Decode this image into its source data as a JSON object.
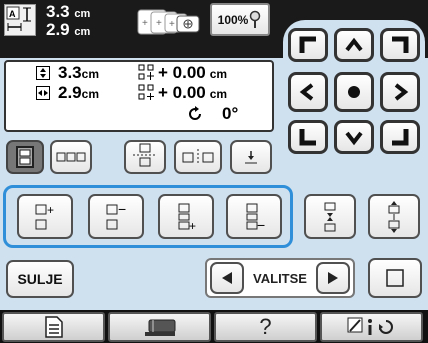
{
  "header": {
    "width_value": "3.3",
    "height_value": "2.9",
    "unit": "cm",
    "zoom_label": "100%"
  },
  "info": {
    "width_value": "3.3",
    "height_value": "2.9",
    "unit": "cm",
    "offset_x": "+ 0.00",
    "offset_y": "+ 0.00",
    "rotation": "0°"
  },
  "buttons": {
    "close_label": "SULJE",
    "select_label": "VALITSE"
  },
  "bottom_bar": {
    "help_label": "?"
  },
  "colors": {
    "background": "#cfe0ef",
    "dark_header": "#1a1a1a",
    "highlight_frame": "#2f8fd8",
    "pressed_button": "#777777",
    "bottom_bar": "#111111"
  }
}
